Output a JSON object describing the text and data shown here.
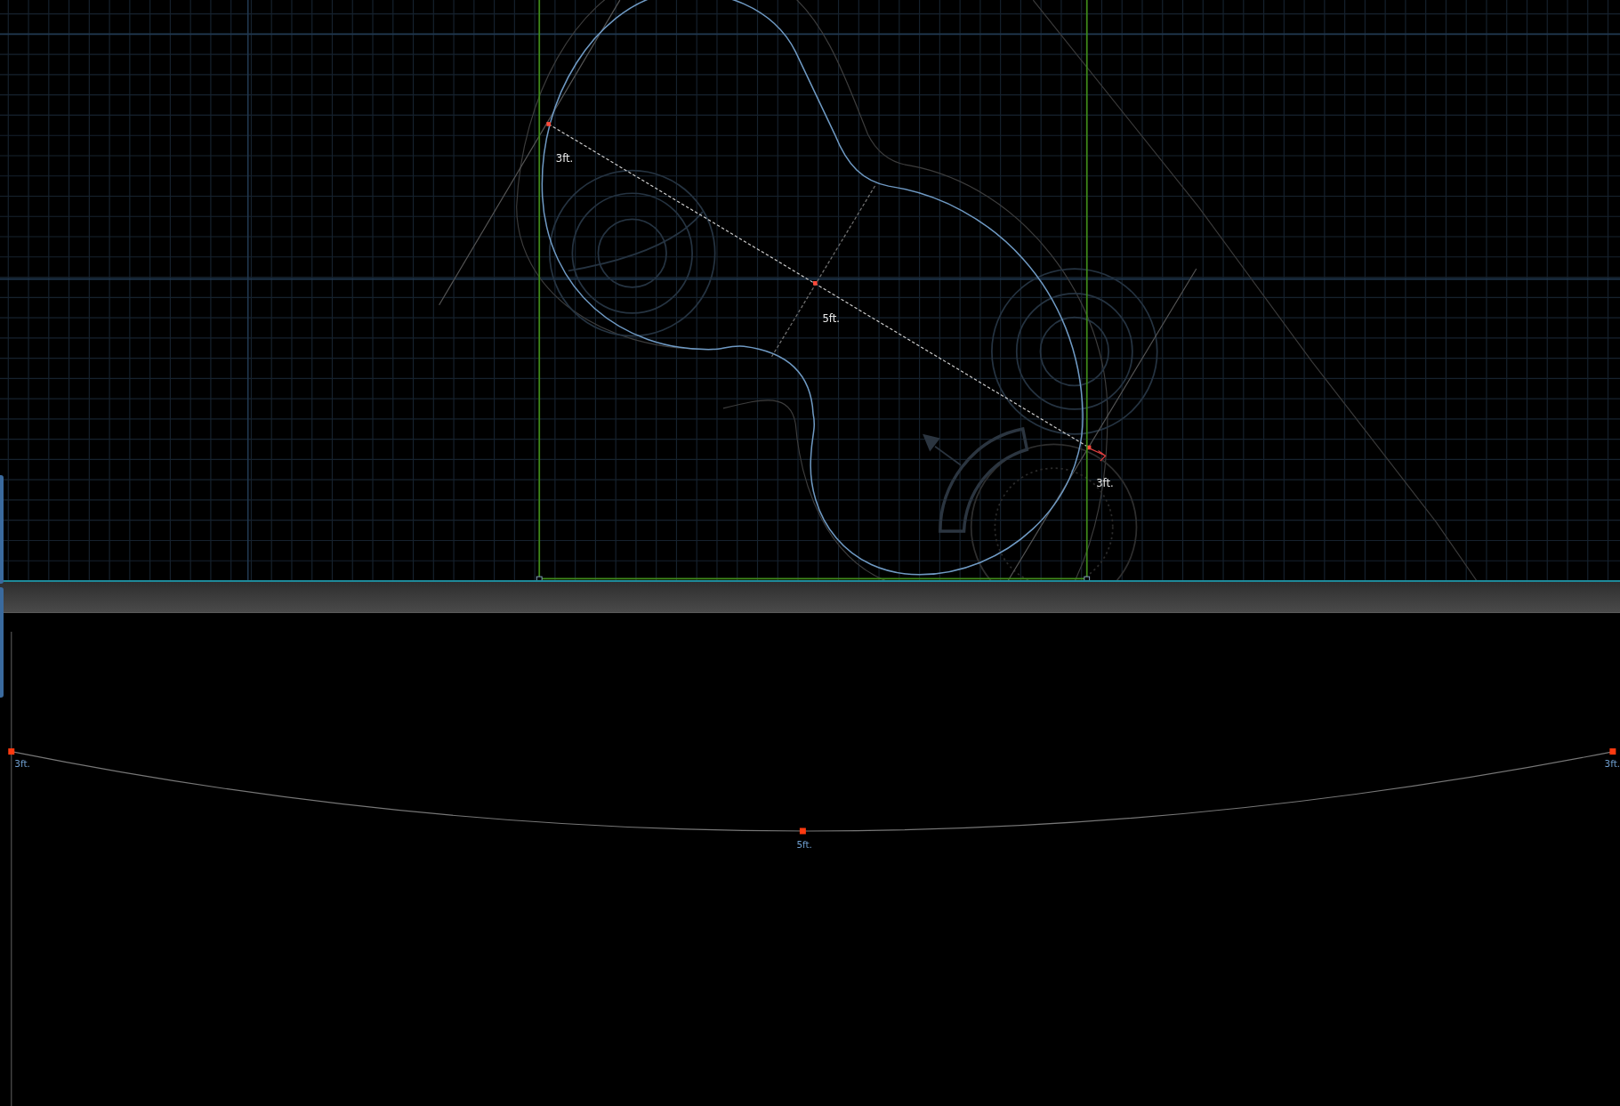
{
  "plan_view": {
    "dimension_labels": [
      "3ft.",
      "5ft.",
      "3ft."
    ]
  },
  "profile_view": {
    "point_labels": [
      "3ft.",
      "5ft.",
      "3ft."
    ]
  }
}
